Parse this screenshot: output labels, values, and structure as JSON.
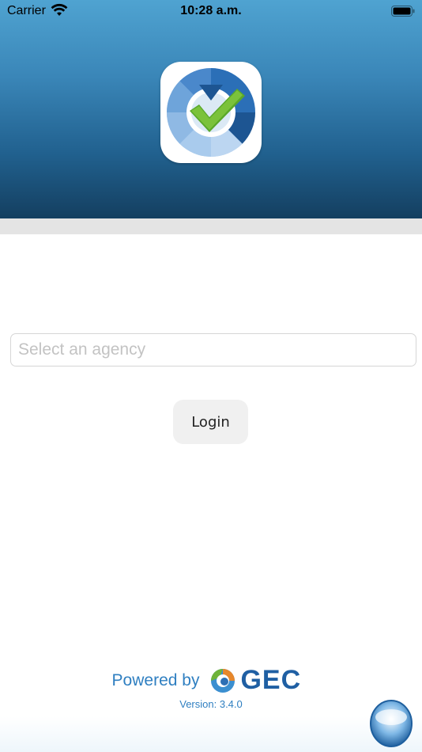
{
  "status_bar": {
    "carrier": "Carrier",
    "time": "10:28 a.m."
  },
  "header": {
    "logo_icon": "checklist-gauge-icon",
    "gradient_colors": [
      "#4fa3d1",
      "#143f60"
    ]
  },
  "form": {
    "agency_placeholder": "Select an agency",
    "agency_value": "",
    "login_label": "Login"
  },
  "footer": {
    "powered_by": "Powered by",
    "brand": "GEC",
    "version": "Version: 3.4.0",
    "accent_color": "#2f7fc1"
  }
}
